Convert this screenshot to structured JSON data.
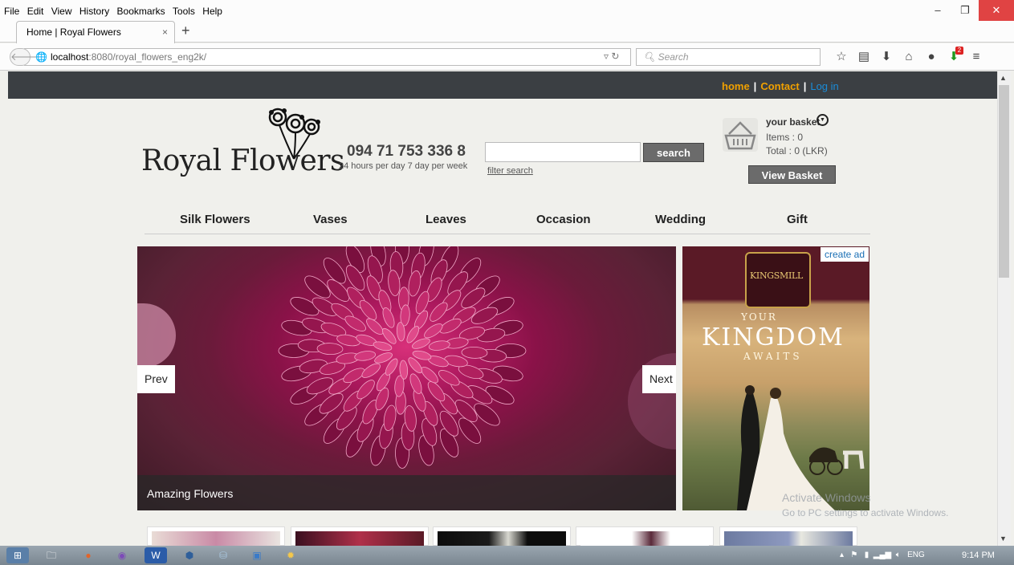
{
  "browser": {
    "menu": [
      "File",
      "Edit",
      "View",
      "History",
      "Bookmarks",
      "Tools",
      "Help"
    ],
    "tab_title": "Home | Royal Flowers",
    "tab_close": "×",
    "new_tab": "+",
    "url_host": "localhost",
    "url_path": ":8080/royal_flowers_eng2k/",
    "search_placeholder": "Search",
    "download_badge": "2"
  },
  "topnav": {
    "home": "home",
    "contact": "Contact",
    "login": "Log in",
    "separator": "|"
  },
  "header": {
    "logo_text": "Royal Flowers",
    "phone": "094 71 753 336 8",
    "hours": "24 hours per day 7 day per week",
    "search_button": "search",
    "filter_link": "filter search"
  },
  "basket": {
    "label": "your basket",
    "items": "Items : 0",
    "total": "Total : 0 (LKR)",
    "view_button": "View Basket"
  },
  "categories": [
    "Silk Flowers",
    "Vases",
    "Leaves",
    "Occasion",
    "Wedding",
    "Gift"
  ],
  "slider": {
    "prev": "Prev",
    "next": "Next",
    "caption": "Amazing Flowers"
  },
  "ad": {
    "create_ad": "create ad",
    "brand": "KINGSMILL",
    "your": "YOUR",
    "kingdom": "KINGDOM",
    "awaits": "AWAITS"
  },
  "watermark": {
    "line1": "Activate Windows",
    "line2": "Go to PC settings to activate Windows."
  },
  "taskbar": {
    "lang": "ENG",
    "time": "9:14 PM"
  },
  "colors": {
    "topbar": "#3b3f43",
    "nav_link": "#f0a000",
    "login_link": "#1a8cd8",
    "button": "#6b6b6b"
  }
}
